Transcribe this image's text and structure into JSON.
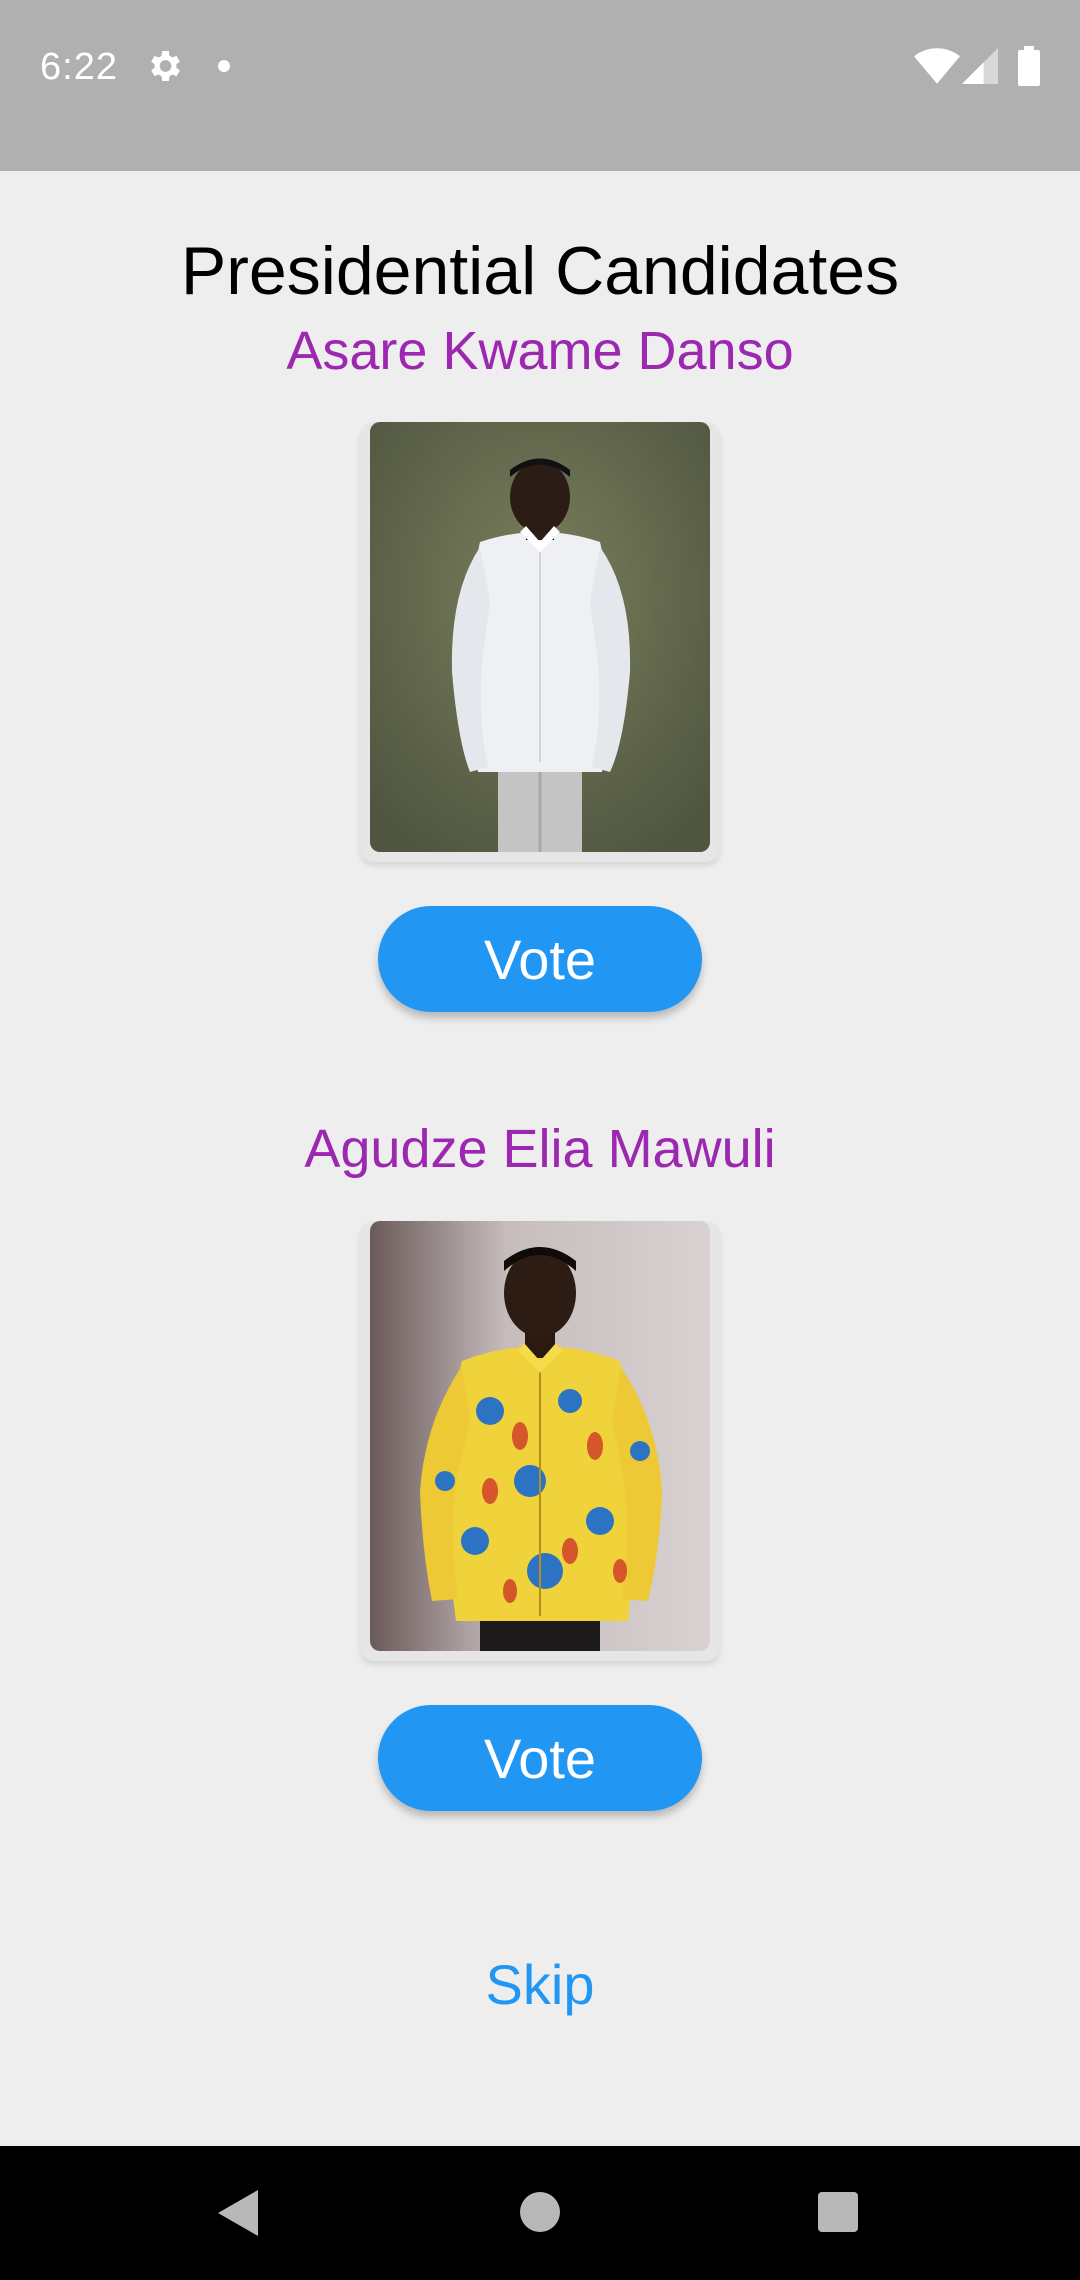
{
  "status_bar": {
    "time": "6:22",
    "icons": [
      "gear-icon",
      "notification-dot-icon",
      "wifi-icon",
      "signal-icon",
      "battery-icon"
    ]
  },
  "page": {
    "title": "Presidential Candidates"
  },
  "candidates": [
    {
      "name": "Asare Kwame Danso",
      "vote_label": "Vote"
    },
    {
      "name": "Agudze Elia Mawuli",
      "vote_label": "Vote"
    }
  ],
  "skip_label": "Skip",
  "nav_bar": {
    "icons": [
      "back-icon",
      "home-icon",
      "recents-icon"
    ]
  },
  "colors": {
    "accent": "#2196f3",
    "name_color": "#9c27b0",
    "background": "#eeeeee",
    "status_bar": "#b0b0b0"
  }
}
